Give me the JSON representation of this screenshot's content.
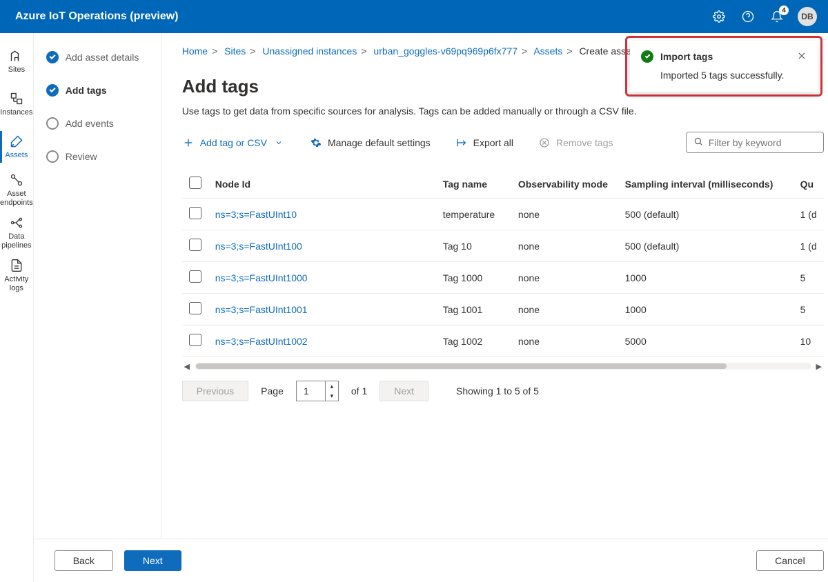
{
  "header": {
    "product_title": "Azure IoT Operations (preview)",
    "notification_count": "4",
    "avatar_initials": "DB"
  },
  "rail": {
    "items": [
      {
        "label": "Sites"
      },
      {
        "label": "Instances"
      },
      {
        "label": "Assets"
      },
      {
        "label": "Asset endpoints"
      },
      {
        "label": "Data pipelines"
      },
      {
        "label": "Activity logs"
      }
    ]
  },
  "breadcrumb": {
    "items": [
      "Home",
      "Sites",
      "Unassigned instances",
      "urban_goggles-v69pq969p6fx777",
      "Assets",
      "Create asset"
    ]
  },
  "steps": {
    "items": [
      {
        "label": "Add asset details"
      },
      {
        "label": "Add tags"
      },
      {
        "label": "Add events"
      },
      {
        "label": "Review"
      }
    ]
  },
  "page_title": "Add tags",
  "page_subtitle": "Use tags to get data from specific sources for analysis. Tags can be added manually or through a CSV file.",
  "toolbar": {
    "add": "Add tag or CSV",
    "manage": "Manage default settings",
    "export": "Export all",
    "remove": "Remove tags",
    "filter_placeholder": "Filter by keyword"
  },
  "table": {
    "columns": [
      "Node Id",
      "Tag name",
      "Observability mode",
      "Sampling interval (milliseconds)",
      "Qu"
    ],
    "rows": [
      {
        "node_id": "ns=3;s=FastUInt10",
        "tag_name": "temperature",
        "obs": "none",
        "sample": "500 (default)",
        "q": "1 (d"
      },
      {
        "node_id": "ns=3;s=FastUInt100",
        "tag_name": "Tag 10",
        "obs": "none",
        "sample": "500 (default)",
        "q": "1 (d"
      },
      {
        "node_id": "ns=3;s=FastUInt1000",
        "tag_name": "Tag 1000",
        "obs": "none",
        "sample": "1000",
        "q": "5"
      },
      {
        "node_id": "ns=3;s=FastUInt1001",
        "tag_name": "Tag 1001",
        "obs": "none",
        "sample": "1000",
        "q": "5"
      },
      {
        "node_id": "ns=3;s=FastUInt1002",
        "tag_name": "Tag 1002",
        "obs": "none",
        "sample": "5000",
        "q": "10"
      }
    ]
  },
  "pager": {
    "prev": "Previous",
    "next": "Next",
    "page_label": "Page",
    "page_value": "1",
    "of_label": "of 1",
    "showing": "Showing 1 to 5 of 5"
  },
  "footer": {
    "back": "Back",
    "next": "Next",
    "cancel": "Cancel"
  },
  "toast": {
    "title": "Import tags",
    "body": "Imported 5 tags successfully."
  }
}
